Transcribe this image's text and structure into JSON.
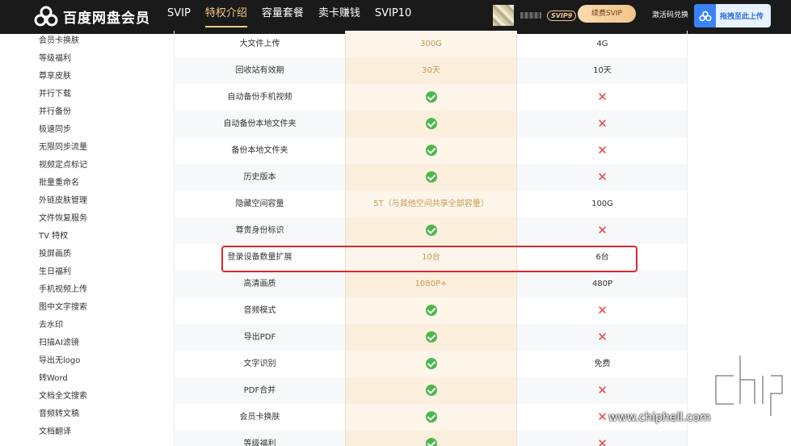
{
  "header": {
    "logo_text": "百度网盘会员",
    "nav": [
      "SVIP",
      "特权介绍",
      "容量套餐",
      "卖卡赚钱",
      "SVIP10"
    ],
    "active_nav": 1,
    "vip_badge": "SVIP9",
    "renew_button": "续费SVIP",
    "redeem_link": "激活码兑换",
    "upload_button": "拖拽至此上传"
  },
  "sidebar": {
    "items": [
      "会员卡换肤",
      "等级福利",
      "尊享皮肤",
      "并行下载",
      "并行备份",
      "极速同步",
      "无限同步流量",
      "视频定点标记",
      "批量重命名",
      "外链皮肤管理",
      "文件恢复服务",
      "TV 特权",
      "投屏画质",
      "生日福利",
      "手机视频上传",
      "图中文字搜索",
      "去水印",
      "扫描AI滤镜",
      "导出无logo",
      "转Word",
      "文档全文搜索",
      "音频转文稿",
      "文档翻译"
    ]
  },
  "table": {
    "rows": [
      {
        "feature": "大文件上传",
        "svip": "300G",
        "vip": "4G"
      },
      {
        "feature": "回收站有效期",
        "svip": "30天",
        "vip": "10天"
      },
      {
        "feature": "自动备份手机视频",
        "svip": "check",
        "vip": "cross"
      },
      {
        "feature": "自动备份本地文件夹",
        "svip": "check",
        "vip": "cross"
      },
      {
        "feature": "备份本地文件夹",
        "svip": "check",
        "vip": "cross"
      },
      {
        "feature": "历史版本",
        "svip": "check",
        "vip": "cross"
      },
      {
        "feature": "隐藏空间容量",
        "svip": "5T（与其他空间共享全部容量）",
        "vip": "100G"
      },
      {
        "feature": "尊贵身份标识",
        "svip": "check",
        "vip": "cross"
      },
      {
        "feature": "登录设备数量扩展",
        "svip": "10台",
        "vip": "6台"
      },
      {
        "feature": "高清画质",
        "svip": "1080P+",
        "vip": "480P"
      },
      {
        "feature": "音频模式",
        "svip": "check",
        "vip": "cross"
      },
      {
        "feature": "导出PDF",
        "svip": "check",
        "vip": "cross"
      },
      {
        "feature": "文字识别",
        "svip": "check",
        "vip": "免费"
      },
      {
        "feature": "PDF合并",
        "svip": "check",
        "vip": "cross"
      },
      {
        "feature": "会员卡换肤",
        "svip": "check",
        "vip": "cross"
      },
      {
        "feature": "等级福利",
        "svip": "check",
        "vip": "cross"
      }
    ],
    "highlighted_row": 8
  },
  "watermark": {
    "text": "www.chiphell.com",
    "logo": "chip hell"
  },
  "colors": {
    "topbar": "#1a1a1a",
    "accent_gold": "#f5c985",
    "check_green": "#4cb84c",
    "cross_red": "#e64340",
    "highlight_red": "#e0262c"
  }
}
